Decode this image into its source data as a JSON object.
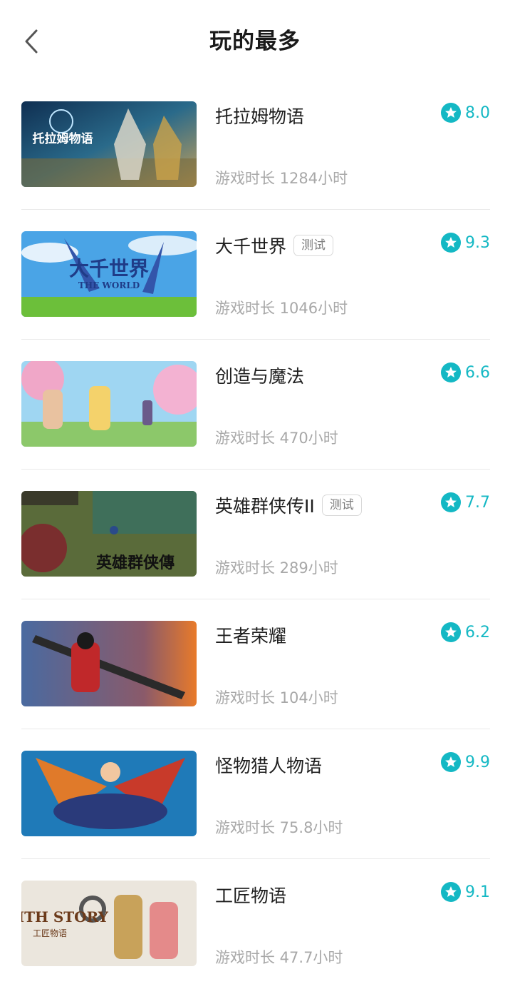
{
  "header": {
    "title": "玩的最多"
  },
  "games": [
    {
      "name": "托拉姆物语",
      "tag": "",
      "rating": "8.0",
      "playtime": "游戏时长 1284小时",
      "thumb_text": "托拉姆物语",
      "theme": "toram"
    },
    {
      "name": "大千世界",
      "tag": "测试",
      "rating": "9.3",
      "playtime": "游戏时长 1046小时",
      "thumb_text": "大千世界",
      "thumb_sub": "THE WORLD",
      "theme": "world"
    },
    {
      "name": "创造与魔法",
      "tag": "",
      "rating": "6.6",
      "playtime": "游戏时长 470小时",
      "thumb_text": "",
      "theme": "magic"
    },
    {
      "name": "英雄群侠传II",
      "tag": "测试",
      "rating": "7.7",
      "playtime": "游戏时长 289小时",
      "thumb_text": "英雄群侠傳",
      "theme": "hero"
    },
    {
      "name": "王者荣耀",
      "tag": "",
      "rating": "6.2",
      "playtime": "游戏时长 104小时",
      "thumb_text": "",
      "theme": "honor"
    },
    {
      "name": "怪物猎人物语",
      "tag": "",
      "rating": "9.9",
      "playtime": "游戏时长 75.8小时",
      "thumb_text": "",
      "theme": "monster"
    },
    {
      "name": "工匠物语",
      "tag": "",
      "rating": "9.1",
      "playtime": "游戏时长 47.7小时",
      "thumb_text": "SMITH STORY",
      "thumb_sub": "工匠物语",
      "theme": "smith"
    }
  ],
  "colors": {
    "accent": "#14b8c4",
    "muted": "#a8a8a8",
    "divider": "#e9e9e9"
  }
}
